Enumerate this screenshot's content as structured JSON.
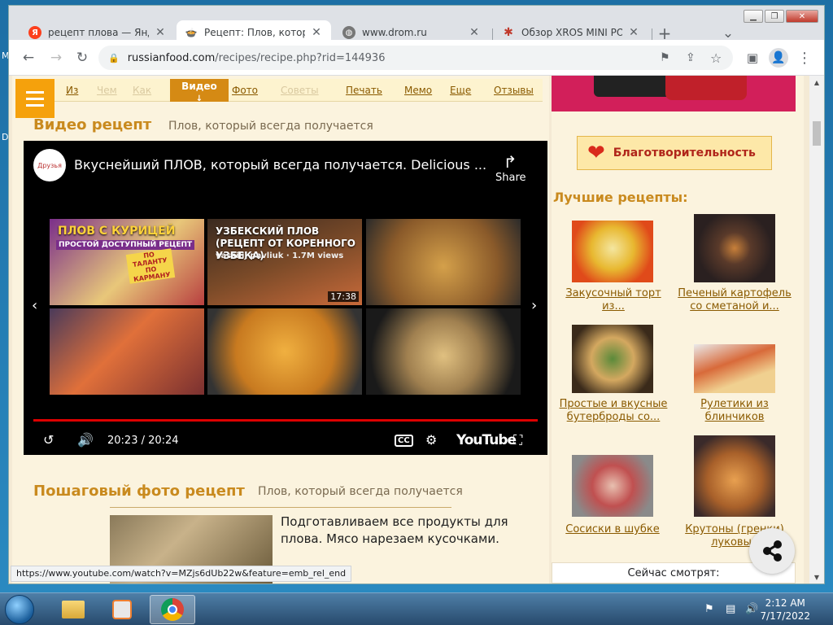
{
  "desktop": {
    "glyph_top": "M",
    "glyph_mid": "D"
  },
  "window": {
    "min": "▁",
    "max": "❐",
    "close": "✕"
  },
  "tabs": [
    {
      "title": "рецепт плова — Яндекс",
      "favicon": "Я",
      "close": "✕"
    },
    {
      "title": "Рецепт: Плов, который",
      "favicon": "🍲",
      "close": "✕"
    },
    {
      "title": "www.drom.ru",
      "favicon": "◍",
      "close": "✕"
    },
    {
      "title": "Обзор XROS MINI POD",
      "favicon": "✱",
      "close": "✕"
    }
  ],
  "newtab": "+",
  "tablist": "⌄",
  "toolbar": {
    "back": "←",
    "forward": "→",
    "reload": "↻",
    "lock": "🔒",
    "url_host": "russianfood.com",
    "url_path": "/recipes/recipe.php?rid=144936",
    "translate": "⚑",
    "share": "⇪",
    "star": "☆",
    "sidepanel": "▣",
    "profile": "👤",
    "menu": "⋮"
  },
  "subnav": {
    "items": [
      "Из",
      "Чем",
      "Как",
      "Фото",
      "Советы",
      "Печать",
      "Мемо",
      "Еще",
      "Отзывы"
    ],
    "active": "Видео",
    "active_arrow": "↓"
  },
  "video_section": {
    "heading": "Видео рецепт",
    "sub": "Плов, который всегда получается"
  },
  "video": {
    "channel": "Друзья",
    "title": "Вкуснейший ПЛОВ, который всегда получается. Delicious ...",
    "share": "Share",
    "share_icon": "↱",
    "thumbs": [
      {
        "cap1": "ПЛОВ С КУРИЦЕЙ",
        "cap2": "ПРОСТОЙ ДОСТУПНЫЙ РЕЦЕПТ",
        "badge": "ПО ТАЛАНТУ ПО КАРМАНУ"
      },
      {
        "cap": "УЗБЕКСКИЙ ПЛОВ (РЕЦЕПТ ОТ КОРЕННОГО УЗБЕКА)",
        "meta": "vassilij pavliuk · 1.7M views",
        "duration": "17:38"
      }
    ],
    "prev": "‹",
    "next": "›",
    "time": "20:23 / 20:24",
    "replay": "↺",
    "volume": "🔊",
    "cc": "CC",
    "settings": "⚙",
    "logo": "YouTube",
    "fullscreen": "⛶"
  },
  "step_section": {
    "heading": "Пошаговый фото рецепт",
    "sub": "Плов, который всегда получается",
    "text": "Подготавливаем все продукты для плова. Мясо нарезаем кусочками."
  },
  "charity": {
    "label": "Благотворительность",
    "icon": "❤"
  },
  "best": {
    "heading": "Лучшие рецепты:",
    "items": [
      {
        "label": "Закусочный торт из..."
      },
      {
        "label": "Печеный картофель со сметаной и..."
      },
      {
        "label": "Простые и вкусные бутерброды со..."
      },
      {
        "label": "Рулетики из блинчиков"
      },
      {
        "label": "Сосиски в шубке"
      },
      {
        "label": "Крутоны (гренки) луковые"
      }
    ]
  },
  "now_watching": "Сейчас смотрят:",
  "status_url": "https://www.youtube.com/watch?v=MZjs6dUb22w&feature=emb_rel_end",
  "scroll": {
    "up": "▲",
    "down": "▼"
  },
  "taskbar": {
    "time": "2:12 AM",
    "date": "7/17/2022",
    "tray_flag": "⚑",
    "tray_net": "▤",
    "tray_vol": "🔊"
  }
}
